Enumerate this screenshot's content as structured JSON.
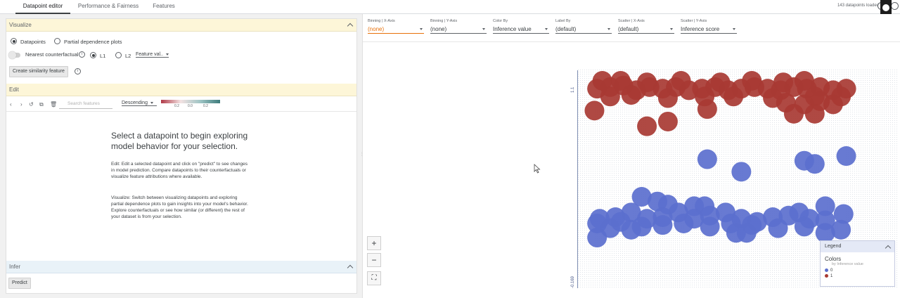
{
  "tabs": [
    {
      "label": "Datapoint editor",
      "active": true
    },
    {
      "label": "Performance & Fairness",
      "active": false
    },
    {
      "label": "Features",
      "active": false
    }
  ],
  "status": {
    "datapoints_loaded": "143 datapoints loaded"
  },
  "visualize": {
    "title": "Visualize",
    "mode_datapoints": "Datapoints",
    "mode_pdp": "Partial dependence plots",
    "nearest_cf": "Nearest counterfactual",
    "l1": "L1",
    "l2": "L2",
    "feature_value": "Feature val..",
    "similarity_button": "Create similarity feature"
  },
  "edit": {
    "title": "Edit",
    "search_placeholder": "Search features",
    "sort": "Descending",
    "gradient_labels": [
      "0.2",
      "0.0",
      "0.2"
    ],
    "heading": "Select a datapoint to begin exploring model behavior for your selection.",
    "para1": "Edit: Edit a selected datapoint and click on \"predict\" to see changes in model prediction. Compare datapoints to their counterfactuals or visualize feature attributions where available.",
    "para2": "Visualize: Switch between visualizing datapoints and exploring partial dependence plots to gain insights into your model's behavior. Explore counterfactuals or see how similar (or different) the rest of your dataset is from your selection."
  },
  "infer": {
    "title": "Infer",
    "predict_button": "Predict"
  },
  "controls": [
    {
      "label": "Binning | X-Axis",
      "value": "(none)",
      "highlight": true
    },
    {
      "label": "Binning | Y-Axis",
      "value": "(none)",
      "highlight": false
    },
    {
      "label": "Color By",
      "value": "Inference value",
      "highlight": false
    },
    {
      "label": "Label By",
      "value": "(default)",
      "highlight": false
    },
    {
      "label": "Scatter | X-Axis",
      "value": "(default)",
      "highlight": false
    },
    {
      "label": "Scatter | Y-Axis",
      "value": "Inference score",
      "highlight": false
    }
  ],
  "axis": {
    "top": "1.1",
    "bottom": "-0.169"
  },
  "legend": {
    "title": "Legend",
    "colors_label": "Colors",
    "sub": "by Inference value",
    "items": [
      {
        "label": "0",
        "color": "#5b6fce"
      },
      {
        "label": "1",
        "color": "#a83a33"
      }
    ]
  },
  "colors": {
    "red": "#a83a33",
    "blue": "#5b6fce",
    "accent_orange": "#e8710a"
  },
  "chart_data": {
    "type": "scatter",
    "y_label": "Inference score",
    "ylim": [
      -0.169,
      1.1
    ],
    "series": [
      {
        "name": "1",
        "color": "#a83a33",
        "points": [
          [
            0.03,
            1.05
          ],
          [
            0.08,
            1.06
          ],
          [
            0.13,
            1.07
          ],
          [
            0.18,
            1.04
          ],
          [
            0.23,
            1.06
          ],
          [
            0.28,
            1.05
          ],
          [
            0.33,
            1.06
          ],
          [
            0.38,
            1.04
          ],
          [
            0.43,
            1.05
          ],
          [
            0.48,
            1.06
          ],
          [
            0.53,
            1.04
          ],
          [
            0.58,
            1.05
          ],
          [
            0.63,
            1.06
          ],
          [
            0.68,
            1.05
          ],
          [
            0.73,
            1.04
          ],
          [
            0.78,
            1.06
          ],
          [
            0.83,
            1.05
          ],
          [
            0.88,
            1.06
          ],
          [
            0.93,
            1.04
          ],
          [
            0.98,
            1.05
          ],
          [
            0.05,
            1.1
          ],
          [
            0.12,
            1.1
          ],
          [
            0.22,
            1.09
          ],
          [
            0.35,
            1.1
          ],
          [
            0.5,
            1.09
          ],
          [
            0.62,
            1.1
          ],
          [
            0.74,
            1.09
          ],
          [
            0.82,
            1.1
          ],
          [
            0.08,
            1.0
          ],
          [
            0.16,
            1.01
          ],
          [
            0.3,
            0.99
          ],
          [
            0.44,
            1.0
          ],
          [
            0.55,
            1.0
          ],
          [
            0.7,
            0.99
          ],
          [
            0.86,
            1.0
          ],
          [
            0.96,
            1.0
          ],
          [
            0.75,
            0.96
          ],
          [
            0.82,
            0.95
          ],
          [
            0.88,
            0.97
          ],
          [
            0.93,
            0.95
          ],
          [
            0.02,
            0.91
          ],
          [
            0.45,
            0.92
          ],
          [
            0.78,
            0.89
          ],
          [
            0.86,
            0.89
          ],
          [
            0.22,
            0.81
          ],
          [
            0.3,
            0.84
          ]
        ]
      },
      {
        "name": "0",
        "color": "#5b6fce",
        "points": [
          [
            0.45,
            0.6
          ],
          [
            0.58,
            0.52
          ],
          [
            0.82,
            0.59
          ],
          [
            0.86,
            0.57
          ],
          [
            0.98,
            0.62
          ],
          [
            0.2,
            0.36
          ],
          [
            0.26,
            0.33
          ],
          [
            0.3,
            0.31
          ],
          [
            0.4,
            0.3
          ],
          [
            0.44,
            0.3
          ],
          [
            0.8,
            0.26
          ],
          [
            0.9,
            0.3
          ],
          [
            0.04,
            0.22
          ],
          [
            0.1,
            0.23
          ],
          [
            0.16,
            0.26
          ],
          [
            0.22,
            0.22
          ],
          [
            0.28,
            0.23
          ],
          [
            0.34,
            0.26
          ],
          [
            0.4,
            0.22
          ],
          [
            0.46,
            0.24
          ],
          [
            0.52,
            0.26
          ],
          [
            0.58,
            0.22
          ],
          [
            0.64,
            0.2
          ],
          [
            0.7,
            0.23
          ],
          [
            0.76,
            0.24
          ],
          [
            0.84,
            0.22
          ],
          [
            0.9,
            0.21
          ],
          [
            0.97,
            0.25
          ],
          [
            0.03,
            0.19
          ],
          [
            0.12,
            0.2
          ],
          [
            0.2,
            0.17
          ],
          [
            0.28,
            0.18
          ],
          [
            0.36,
            0.19
          ],
          [
            0.46,
            0.17
          ],
          [
            0.54,
            0.19
          ],
          [
            0.62,
            0.18
          ],
          [
            0.72,
            0.16
          ],
          [
            0.82,
            0.17
          ],
          [
            0.96,
            0.15
          ],
          [
            0.56,
            0.13
          ],
          [
            0.6,
            0.13
          ],
          [
            0.9,
            0.13
          ],
          [
            0.08,
            0.16
          ],
          [
            0.16,
            0.15
          ],
          [
            0.03,
            0.1
          ]
        ]
      }
    ]
  }
}
